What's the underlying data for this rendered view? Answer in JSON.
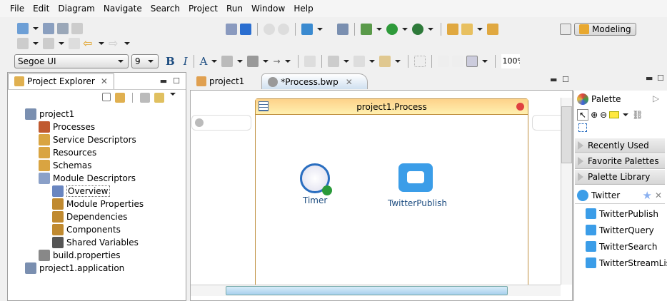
{
  "menu": [
    "File",
    "Edit",
    "Diagram",
    "Navigate",
    "Search",
    "Project",
    "Run",
    "Window",
    "Help"
  ],
  "toolbar": {
    "font": "Segoe UI",
    "font_size": "9",
    "bold": "B",
    "italic": "I",
    "text_color": "A",
    "zoom": "100%",
    "perspective": "Modeling"
  },
  "explorer": {
    "title": "Project Explorer",
    "tree": [
      {
        "label": "project1",
        "level": 0,
        "color": "#7a8fb0"
      },
      {
        "label": "Processes",
        "level": 1,
        "color": "#c05a30"
      },
      {
        "label": "Service Descriptors",
        "level": 1,
        "color": "#d9a441"
      },
      {
        "label": "Resources",
        "level": 1,
        "color": "#d9a441"
      },
      {
        "label": "Schemas",
        "level": 1,
        "color": "#d9a441"
      },
      {
        "label": "Module Descriptors",
        "level": 1,
        "color": "#8aa0c8"
      },
      {
        "label": "Overview",
        "level": 2,
        "color": "#6a86c0"
      },
      {
        "label": "Module Properties",
        "level": 2,
        "color": "#c08a30"
      },
      {
        "label": "Dependencies",
        "level": 2,
        "color": "#c08a30"
      },
      {
        "label": "Components",
        "level": 2,
        "color": "#c08a30"
      },
      {
        "label": "Shared Variables",
        "level": 2,
        "color": "#555"
      },
      {
        "label": "build.properties",
        "level": 1,
        "color": "#888"
      },
      {
        "label": "project1.application",
        "level": 0,
        "color": "#7a8fb0"
      }
    ]
  },
  "editor": {
    "tabs": [
      "project1",
      "*Process.bwp"
    ],
    "process_title": "project1.Process",
    "activities": [
      {
        "label": "Timer"
      },
      {
        "label": "TwitterPublish"
      }
    ]
  },
  "palette": {
    "title": "Palette",
    "drawers": [
      "Recently Used",
      "Favorite Palettes",
      "Palette Library"
    ],
    "group": "Twitter",
    "items": [
      "TwitterPublish",
      "TwitterQuery",
      "TwitterSearch",
      "TwitterStreamList"
    ]
  },
  "colors": {
    "process_header": "#fdd28a",
    "accent": "#3b9de8"
  }
}
